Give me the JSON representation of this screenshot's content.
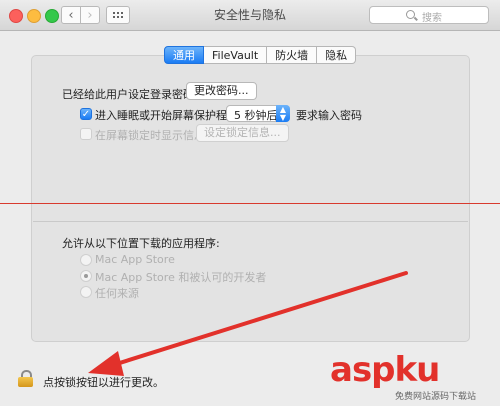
{
  "window": {
    "title": "安全性与隐私"
  },
  "search": {
    "placeholder": "搜索"
  },
  "tabs": [
    "通用",
    "FileVault",
    "防火墙",
    "隐私"
  ],
  "general": {
    "password_set_text": "已经给此用户设定登录密码",
    "change_password_button": "更改密码...",
    "require_password_label": "进入睡眠或开始屏幕保护程序",
    "require_password_checked": true,
    "delay_value": "5 秒钟后",
    "require_password_suffix": "要求输入密码",
    "show_message_label": "在屏幕锁定时显示信息",
    "show_message_checked": false,
    "set_lock_message_button": "设定锁定信息..."
  },
  "downloads": {
    "heading": "允许从以下位置下载的应用程序:",
    "options": [
      "Mac App Store",
      "Mac App Store 和被认可的开发者",
      "任何来源"
    ],
    "selected_index": 1
  },
  "lock_text": "点按锁按钮以进行更改。",
  "watermark": {
    "brand": "aspku",
    "sub": "免费网站源码下载站"
  },
  "colors": {
    "accent": "#1b7cf4",
    "annotation": "#e2312b"
  }
}
